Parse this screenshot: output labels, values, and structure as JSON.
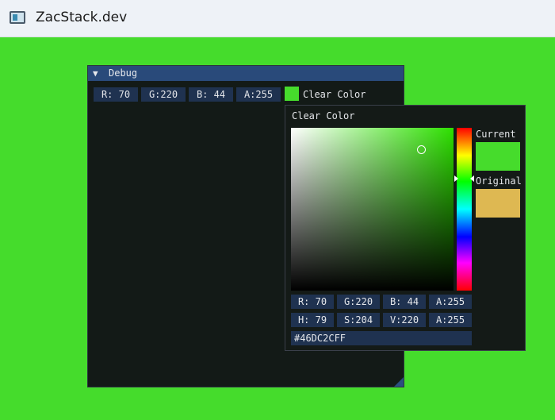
{
  "window": {
    "title": "ZacStack.dev"
  },
  "colors": {
    "clear_color": "#46DC2C",
    "original_color": "#DEB852",
    "background": "#45dc2c"
  },
  "debug": {
    "title": "Debug",
    "collapse_icon": "▼",
    "fields": [
      "R: 70",
      "G:220",
      "B: 44",
      "A:255"
    ],
    "label": "Clear Color"
  },
  "picker": {
    "title": "Clear Color",
    "current_label": "Current",
    "original_label": "Original",
    "rgba": [
      "R: 70",
      "G:220",
      "B: 44",
      "A:255"
    ],
    "hsva": [
      "H: 79",
      "S:204",
      "V:220",
      "A:255"
    ],
    "hex": "#46DC2CFF"
  }
}
